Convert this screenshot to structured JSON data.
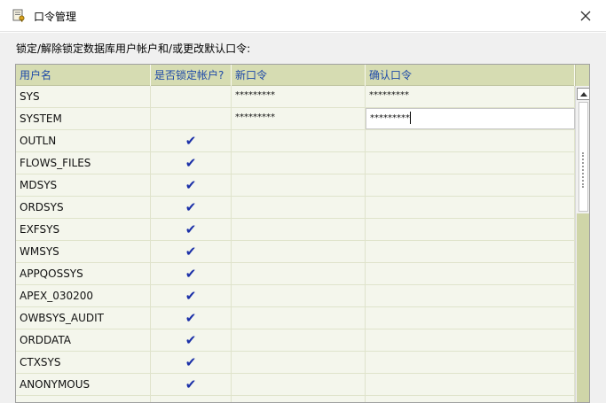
{
  "window": {
    "title": "口令管理"
  },
  "instruction": "锁定/解除锁定数据库用户帐户和/或更改默认口令:",
  "table": {
    "columns": [
      "用户名",
      "是否锁定帐户?",
      "新口令",
      "确认口令"
    ],
    "rows": [
      {
        "user": "SYS",
        "locked": "",
        "new_password": "*********",
        "confirm_password": "*********"
      },
      {
        "user": "SYSTEM",
        "locked": "",
        "new_password": "*********",
        "confirm_password": "*********"
      },
      {
        "user": "OUTLN",
        "locked": "✔",
        "new_password": "",
        "confirm_password": ""
      },
      {
        "user": "FLOWS_FILES",
        "locked": "✔",
        "new_password": "",
        "confirm_password": ""
      },
      {
        "user": "MDSYS",
        "locked": "✔",
        "new_password": "",
        "confirm_password": ""
      },
      {
        "user": "ORDSYS",
        "locked": "✔",
        "new_password": "",
        "confirm_password": ""
      },
      {
        "user": "EXFSYS",
        "locked": "✔",
        "new_password": "",
        "confirm_password": ""
      },
      {
        "user": "WMSYS",
        "locked": "✔",
        "new_password": "",
        "confirm_password": ""
      },
      {
        "user": "APPQOSSYS",
        "locked": "✔",
        "new_password": "",
        "confirm_password": ""
      },
      {
        "user": "APEX_030200",
        "locked": "✔",
        "new_password": "",
        "confirm_password": ""
      },
      {
        "user": "OWBSYS_AUDIT",
        "locked": "✔",
        "new_password": "",
        "confirm_password": ""
      },
      {
        "user": "ORDDATA",
        "locked": "✔",
        "new_password": "",
        "confirm_password": ""
      },
      {
        "user": "CTXSYS",
        "locked": "✔",
        "new_password": "",
        "confirm_password": ""
      },
      {
        "user": "ANONYMOUS",
        "locked": "✔",
        "new_password": "",
        "confirm_password": ""
      },
      {
        "user": "",
        "locked": "",
        "new_password": "",
        "confirm_password": ""
      }
    ]
  },
  "icons": {
    "title": "key-document-icon",
    "close": "close-icon",
    "check": "checkmark-icon"
  },
  "colors": {
    "header_bg": "#d6dcb2",
    "header_text": "#1c48a8",
    "check": "#1a2fa8"
  }
}
